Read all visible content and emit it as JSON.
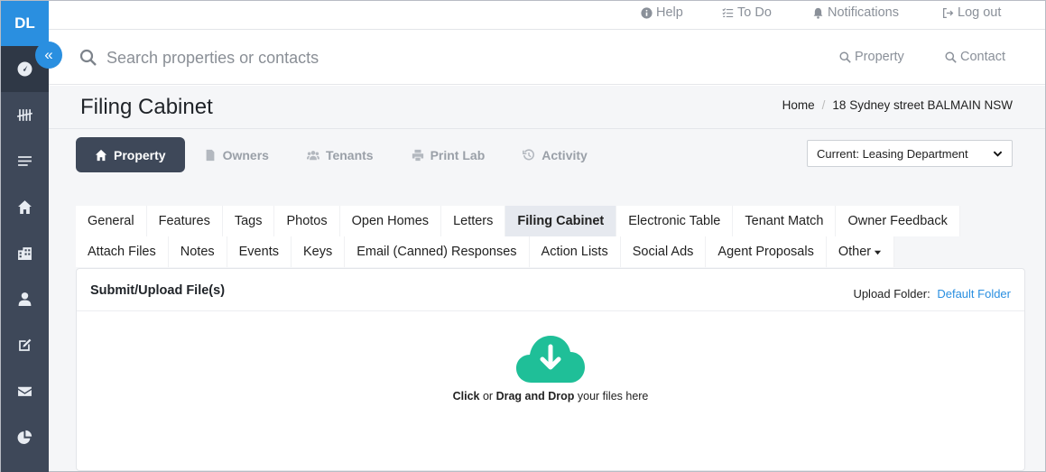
{
  "sidebar": {
    "logo": "DL",
    "items": [
      {
        "icon": "dashboard-icon"
      },
      {
        "icon": "tally-icon"
      },
      {
        "icon": "list-icon"
      },
      {
        "icon": "home-icon"
      },
      {
        "icon": "building-icon"
      },
      {
        "icon": "user-icon"
      },
      {
        "icon": "edit-icon"
      },
      {
        "icon": "mail-icon"
      },
      {
        "icon": "pie-chart-icon"
      }
    ],
    "collapse_glyph": "«"
  },
  "topbar": {
    "help": "Help",
    "todo": "To Do",
    "notifications": "Notifications",
    "logout": "Log out"
  },
  "search": {
    "placeholder": "Search properties or contacts",
    "type_property": "Property",
    "type_contact": "Contact"
  },
  "page": {
    "title": "Filing Cabinet",
    "breadcrumb": [
      "Home",
      "18 Sydney street BALMAIN NSW"
    ]
  },
  "mainnav": {
    "items": [
      "Property",
      "Owners",
      "Tenants",
      "Print Lab",
      "Activity"
    ],
    "active": "Property"
  },
  "department": {
    "selected": "Current: Leasing Department"
  },
  "tabs": {
    "row1": [
      "General",
      "Features",
      "Tags",
      "Photos",
      "Open Homes",
      "Letters",
      "Filing Cabinet",
      "Electronic Table",
      "Tenant Match",
      "Owner Feedback"
    ],
    "row2": [
      "Attach Files",
      "Notes",
      "Events",
      "Keys",
      "Email (Canned) Responses",
      "Action Lists",
      "Social Ads",
      "Agent Proposals",
      "Other"
    ],
    "active": "Filing Cabinet"
  },
  "upload": {
    "title": "Submit/Upload File(s)",
    "folder_label": "Upload Folder:",
    "folder_value": "Default Folder",
    "drop_click": "Click",
    "drop_or": "or",
    "drop_drag": "Drag and Drop",
    "drop_suffix": "your files here",
    "accent_color": "#1fbf98"
  },
  "colors": {
    "sidebar": "#3e4859",
    "accent": "#2a8fe0"
  }
}
